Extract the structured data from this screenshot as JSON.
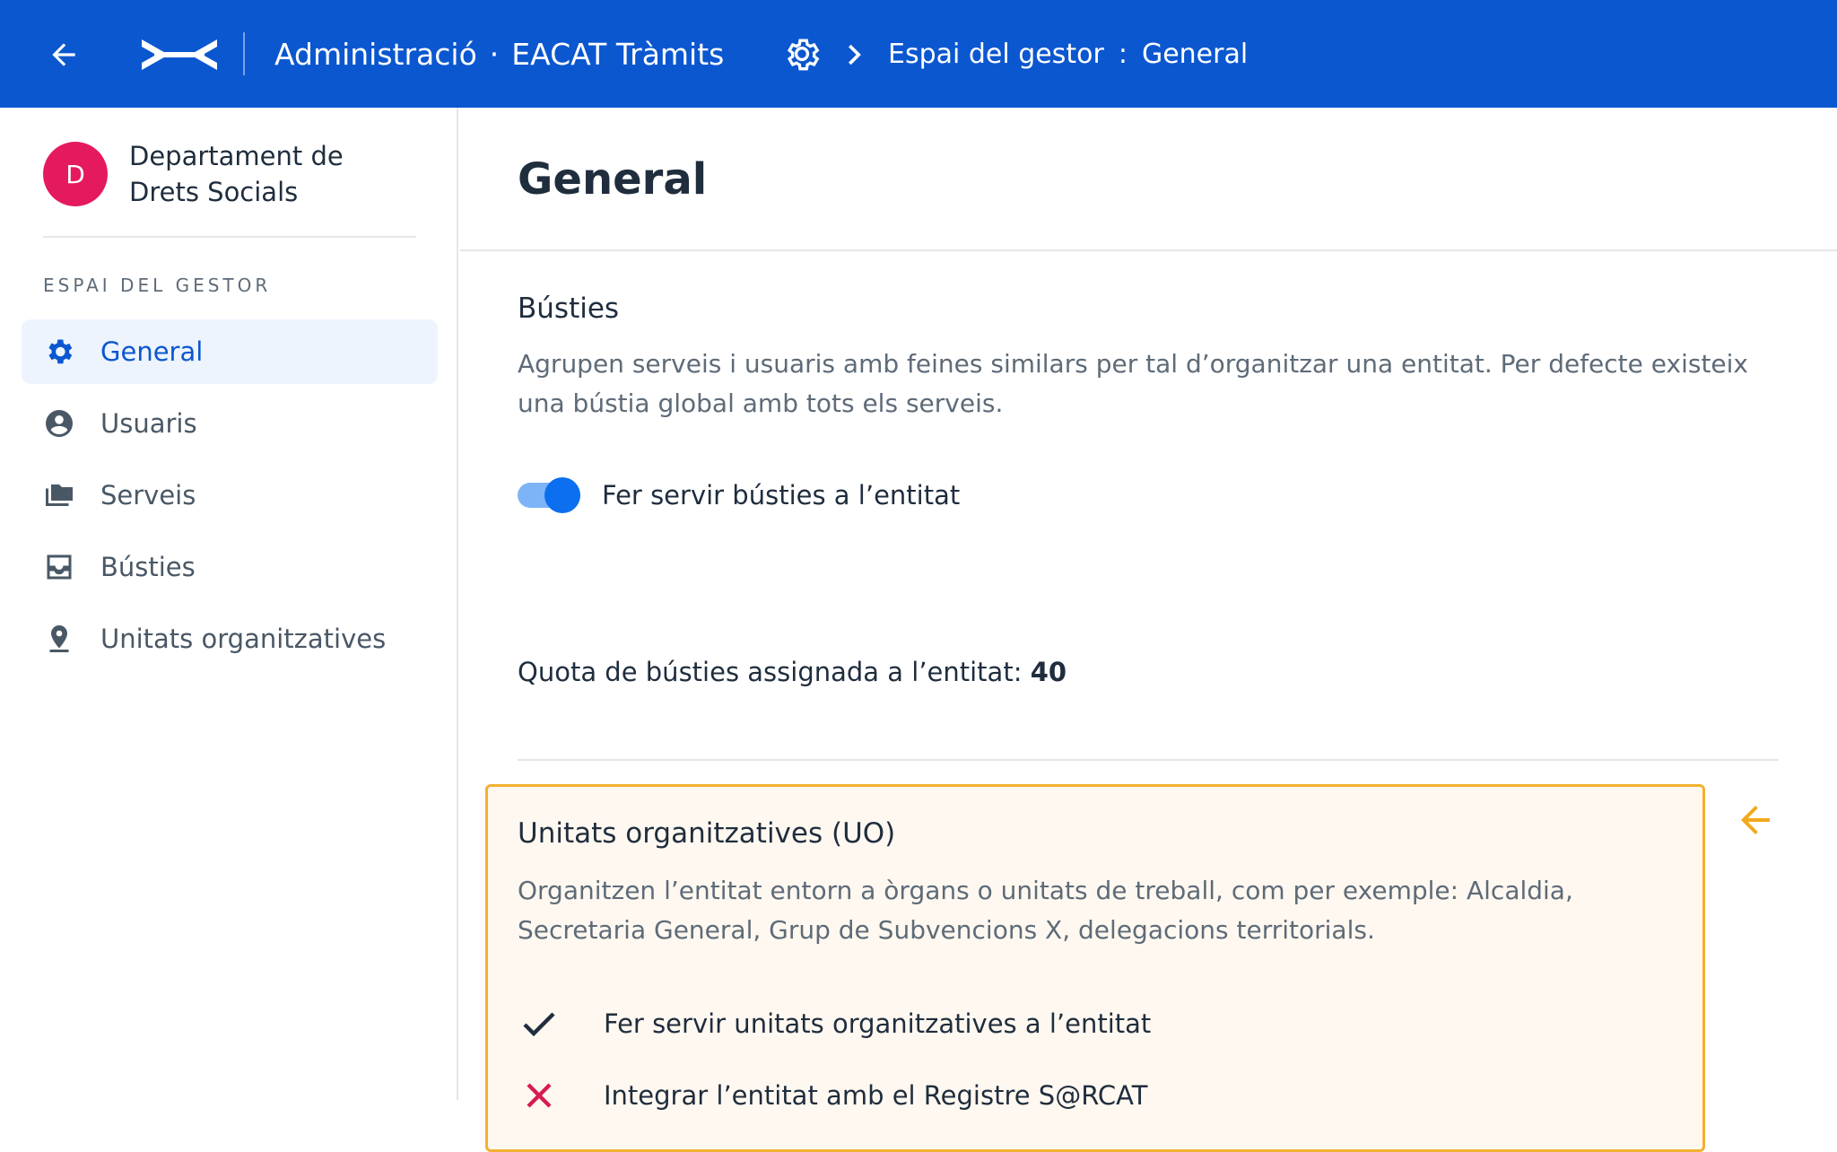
{
  "topbar": {
    "app_name": "Administració",
    "separator": "·",
    "product": "EACAT Tràmits",
    "breadcrumb_section": "Espai del gestor",
    "breadcrumb_separator": ":",
    "breadcrumb_page": "General",
    "icons": [
      "arrow-left-icon",
      "eacat-logo",
      "gear-icon",
      "chevron-right-icon"
    ]
  },
  "sidebar": {
    "org_initial": "D",
    "org_name": "Departament de Drets Socials",
    "heading": "ESPAI DEL GESTOR",
    "items": [
      {
        "label": "General",
        "icon": "gear-icon",
        "active": true
      },
      {
        "label": "Usuaris",
        "icon": "user-circle-icon",
        "active": false
      },
      {
        "label": "Serveis",
        "icon": "folders-icon",
        "active": false
      },
      {
        "label": "Bústies",
        "icon": "inbox-icon",
        "active": false
      },
      {
        "label": "Unitats organitzatives",
        "icon": "location-pin-icon",
        "active": false
      }
    ]
  },
  "main": {
    "title": "General",
    "busties": {
      "title": "Bústies",
      "description": "Agrupen serveis i usuaris amb feines similars per tal d’organitzar una entitat. Per defecte existeix una bústia global amb tots els serveis.",
      "toggle_label": "Fer servir bústies a l’entitat",
      "toggle_on": true,
      "quota_label": "Quota de bústies assignada a l’entitat:",
      "quota_value": "40"
    },
    "uo": {
      "title": "Unitats organitzatives (UO)",
      "description": "Organitzen l’entitat entorn a òrgans o unitats de treball, com per exemple: Alcaldia, Secretaria General, Grup de Subvencions X, delegacions territorials.",
      "items": [
        {
          "label": "Fer servir unitats organitzatives a l’entitat",
          "status": "enabled",
          "icon": "check-icon"
        },
        {
          "label": "Integrar l’entitat amb el Registre S@RCAT",
          "status": "disabled",
          "icon": "close-icon"
        }
      ]
    }
  },
  "colors": {
    "topbar": "#0b57d0",
    "avatar": "#e5195e",
    "highlight_border": "#f2b12f",
    "highlight_bg": "#fff8f0",
    "error": "#d81b4f"
  }
}
